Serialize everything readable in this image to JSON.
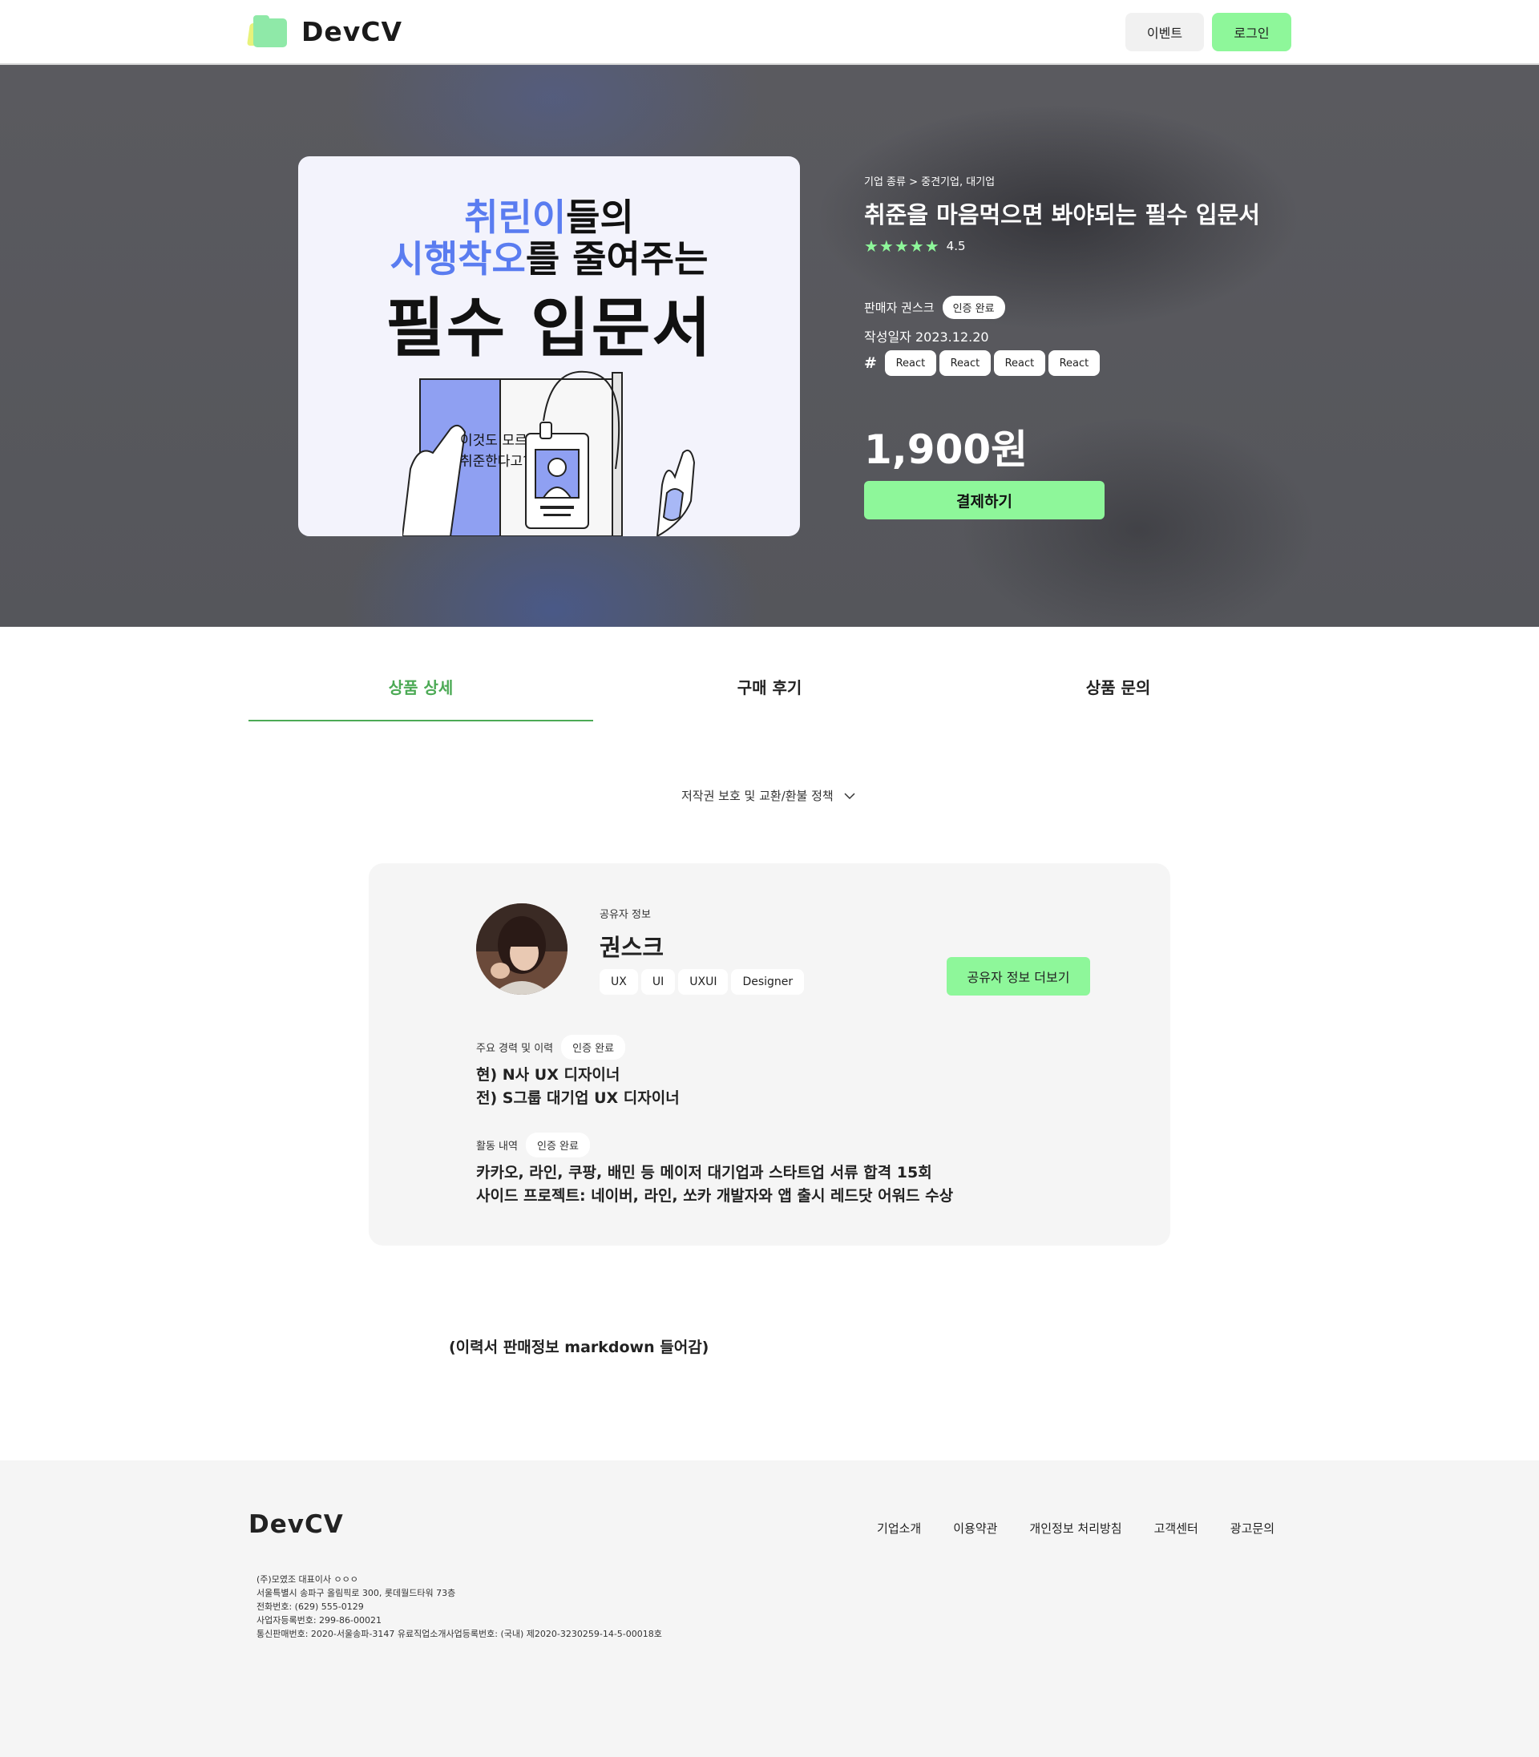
{
  "header": {
    "logo_text": "DevCV",
    "event_label": "이벤트",
    "login_label": "로그인"
  },
  "hero": {
    "card": {
      "line1_highlight": "취린이",
      "line1_rest": "들의",
      "line2_highlight": "시행착오",
      "line2_rest": "를 줄여주는",
      "line3": "필수 입문서",
      "bubble_line1": "이것도 모르고",
      "bubble_line2": "취준한다고?"
    },
    "breadcrumb": "기업 종류 > 중견기업, 대기업",
    "title": "취준을 마음먹으면 봐야되는 필수 입문서",
    "stars": "★★★★★",
    "rating": "4.5",
    "seller": "판매자 권스크",
    "verified": "인증 완료",
    "date": "작성일자 2023.12.20",
    "hash": "#",
    "tags": [
      "React",
      "React",
      "React",
      "React"
    ],
    "price": "1,900원",
    "pay_label": "결제하기"
  },
  "tabs": [
    {
      "label": "상품 상세",
      "active": true
    },
    {
      "label": "구매 후기",
      "active": false
    },
    {
      "label": "상품 문의",
      "active": false
    }
  ],
  "policy": "저작권 보호 및 교환/환불 정책",
  "sharer": {
    "label": "공유자 정보",
    "name": "권스크",
    "skills": [
      "UX",
      "UI",
      "UXUI",
      "Designer"
    ],
    "more_label": "공유자 정보 더보기",
    "career_title": "주요 경력 및 이력",
    "career_badge": "인증 완료",
    "career_lines": [
      "현) N사 UX 디자이너",
      "전) S그룹 대기업 UX 디자이너"
    ],
    "activity_title": "활동 내역",
    "activity_badge": "인증 완료",
    "activity_lines": [
      "카카오, 라인, 쿠팡, 배민 등 메이저 대기업과 스타트업 서류 합격 15회",
      "사이드 프로젝트: 네이버, 라인, 쏘카 개발자와 앱 출시 레드닷 어워드 수상"
    ]
  },
  "markdown_note": "(이력서 판매정보 markdown 들어감)",
  "footer": {
    "logo_text": "DevCV",
    "links": [
      "기업소개",
      "이용약관",
      "개인정보 처리방침",
      "고객센터",
      "광고문의"
    ],
    "info": [
      "(주)모였조   대표이사 ㅇㅇㅇ",
      "서울특별시 송파구 올림픽로 300, 롯데월드타워 73층",
      "전화번호: (629) 555-0129",
      "사업자등록번호: 299-86-00021",
      "통신판매번호: 2020-서울송파-3147  유료직업소개사업등록번호: (국내) 제2020-3230259-14-5-00018호"
    ]
  },
  "colors": {
    "accent_green": "#8ef79a",
    "tab_active": "#4caa55",
    "highlight_blue": "#5a7cf0"
  }
}
